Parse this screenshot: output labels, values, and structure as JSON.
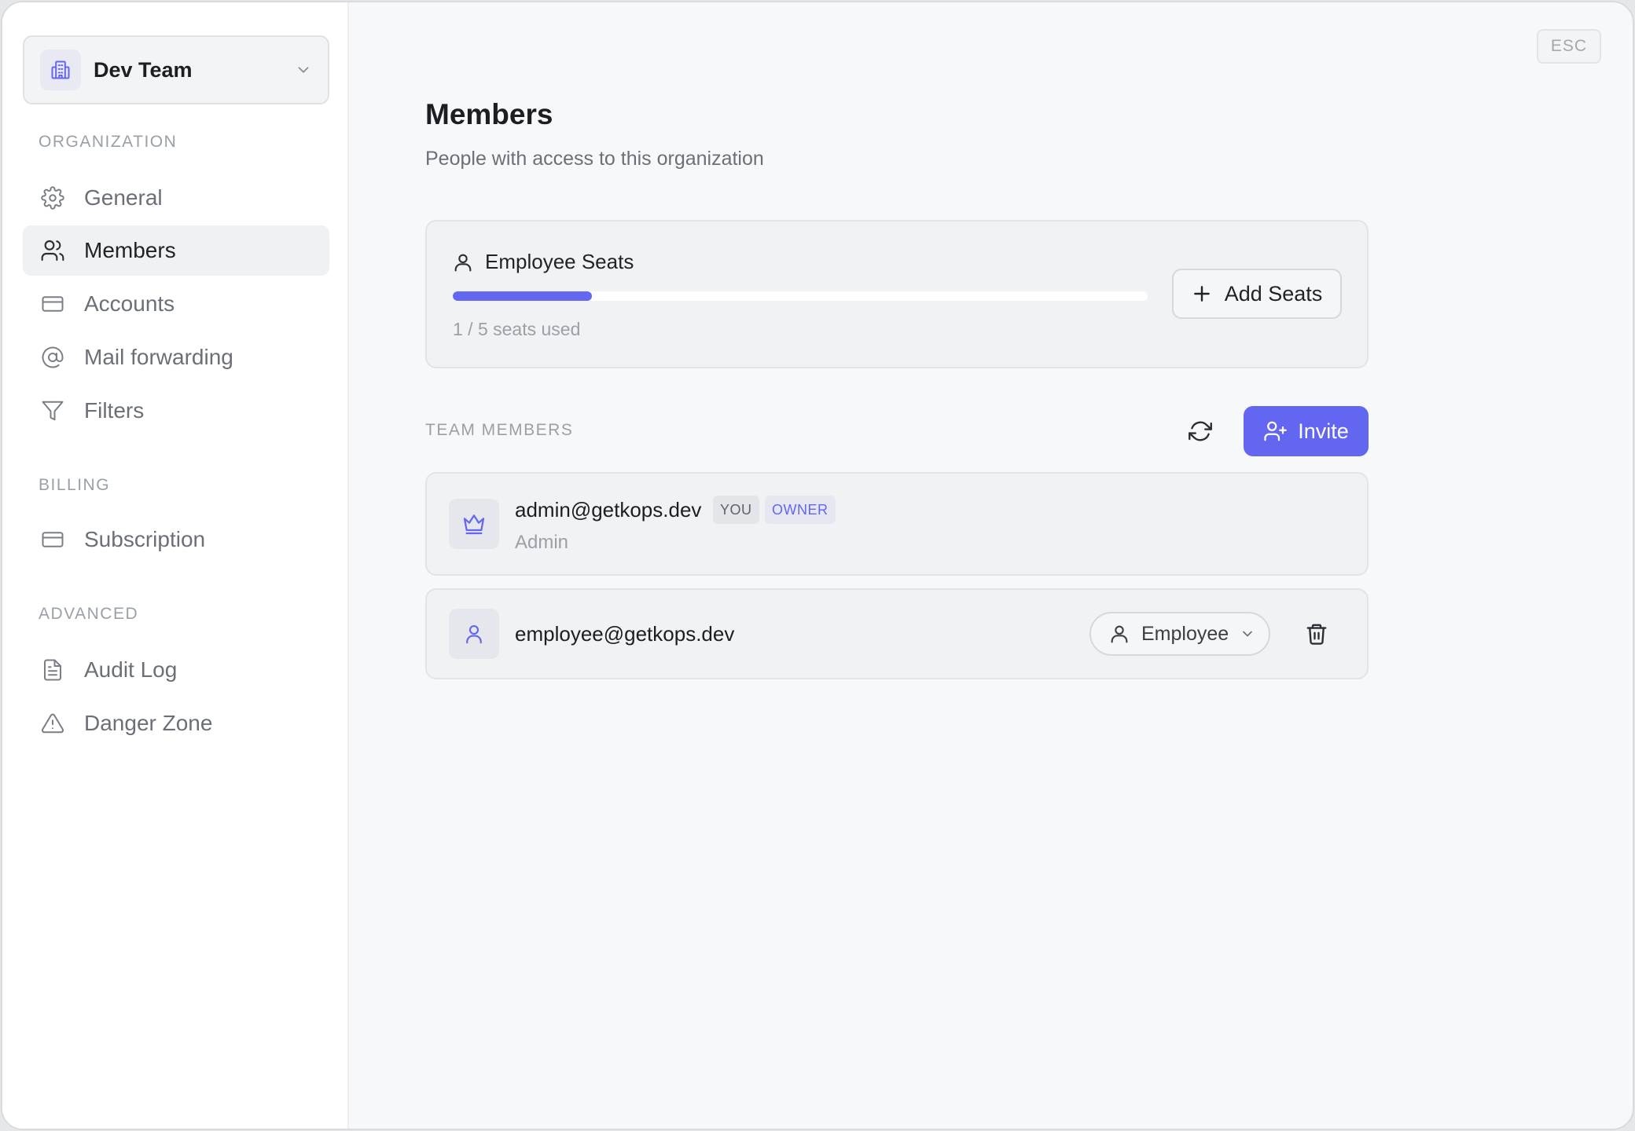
{
  "sidebar": {
    "team": {
      "name": "Dev Team",
      "logo_icon": "building-icon"
    },
    "sections": {
      "organization": "ORGANIZATION",
      "billing": "BILLING",
      "advanced": "ADVANCED"
    },
    "items": {
      "general": {
        "label": "General",
        "icon": "gear-icon"
      },
      "members": {
        "label": "Members",
        "icon": "users-icon",
        "active": true
      },
      "accounts": {
        "label": "Accounts",
        "icon": "card-icon"
      },
      "mail_forwarding": {
        "label": "Mail forwarding",
        "icon": "at-sign-icon"
      },
      "filters": {
        "label": "Filters",
        "icon": "filter-icon"
      },
      "subscription": {
        "label": "Subscription",
        "icon": "card-icon"
      },
      "audit_log": {
        "label": "Audit Log",
        "icon": "document-icon"
      },
      "danger_zone": {
        "label": "Danger Zone",
        "icon": "warning-icon"
      }
    }
  },
  "header": {
    "esc_label": "ESC"
  },
  "main": {
    "title": "Members",
    "subtitle": "People with access to this organization",
    "seats": {
      "label": "Employee Seats",
      "used": 1,
      "total": 5,
      "used_text": "1 / 5 seats used",
      "add_label": "Add Seats"
    },
    "team_members_label": "TEAM MEMBERS",
    "invite_label": "Invite",
    "members": [
      {
        "email": "admin@getkops.dev",
        "role": "Admin",
        "badges": [
          "YOU",
          "OWNER"
        ],
        "avatar_icon": "crown-icon"
      },
      {
        "email": "employee@getkops.dev",
        "role_select": "Employee",
        "avatar_icon": "user-icon"
      }
    ]
  },
  "colors": {
    "accent": "#6366f1",
    "background": "#f7f8fa",
    "sidebar": "#ffffff",
    "muted_text": "#9aa0a8"
  }
}
